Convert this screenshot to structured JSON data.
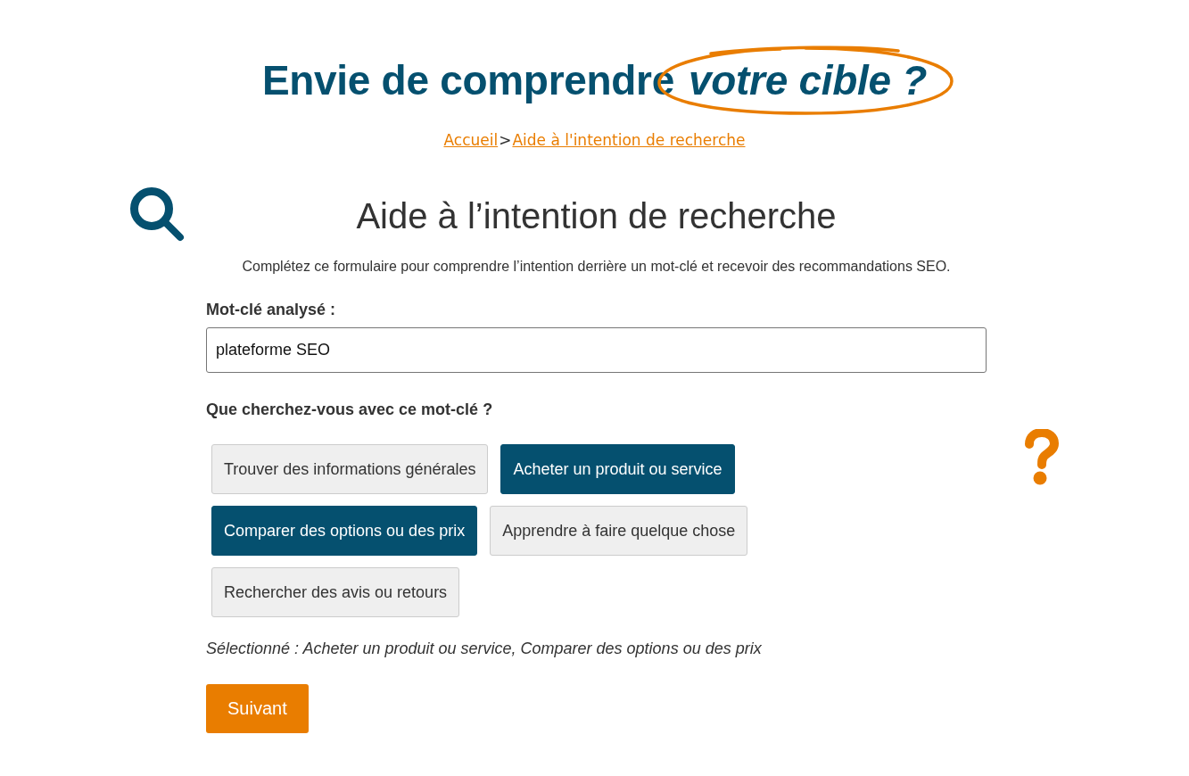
{
  "header": {
    "title": "Envie de comprendre",
    "highlight": "votre cible ?"
  },
  "breadcrumb": {
    "items": [
      {
        "label": "Accueil"
      },
      {
        "label": "Aide à l'intention de recherche"
      }
    ],
    "separator": ">"
  },
  "form": {
    "title": "Aide à l’intention de recherche",
    "description": "Complétez ce formulaire pour comprendre l’intention derrière un mot-clé et recevoir des recommandations SEO.",
    "keyword_label": "Mot-clé analysé :",
    "keyword_value": "plateforme SEO",
    "question": "Que cherchez-vous avec ce mot-clé ?",
    "options": [
      {
        "label": "Trouver des informations générales",
        "selected": false
      },
      {
        "label": "Acheter un produit ou service",
        "selected": true
      },
      {
        "label": "Comparer des options ou des prix",
        "selected": true
      },
      {
        "label": "Apprendre à faire quelque chose",
        "selected": false
      },
      {
        "label": "Rechercher des avis ou retours",
        "selected": false
      }
    ],
    "selection_summary": "Sélectionné : Acheter un produit ou service, Comparer des options ou des prix",
    "next_button": "Suivant"
  }
}
